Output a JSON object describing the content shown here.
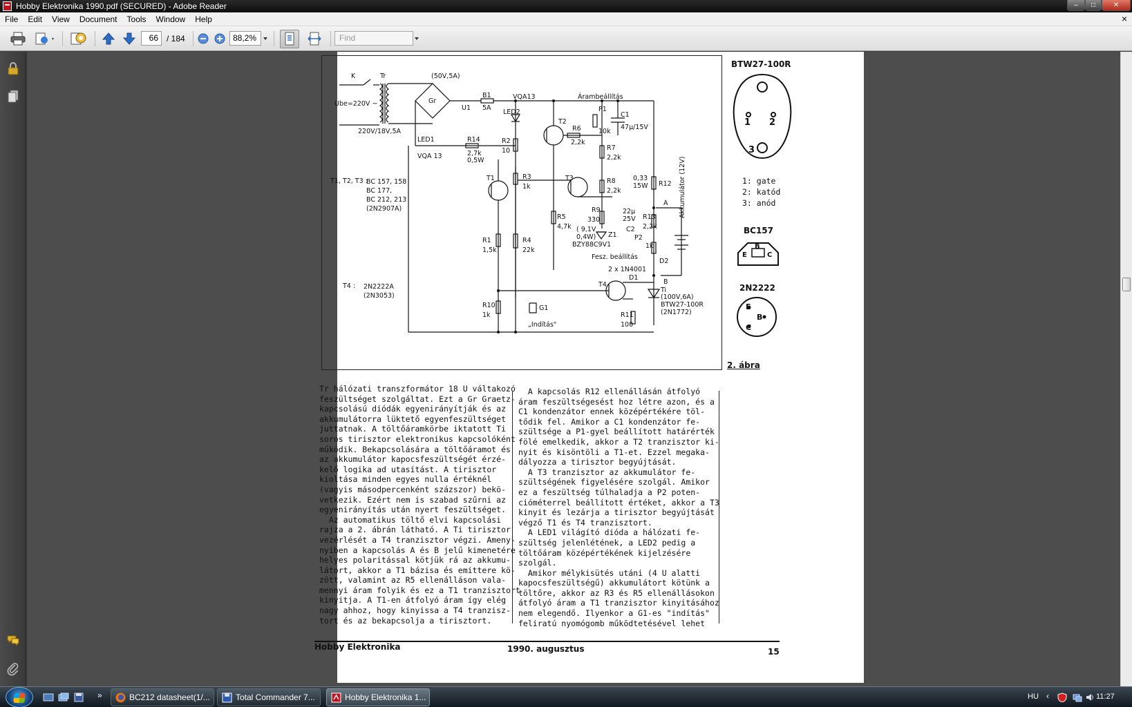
{
  "window": {
    "title": "Hobby Elektronika 1990.pdf (SECURED) - Adobe Reader",
    "controls": {
      "minimize": "–",
      "maximize": "□",
      "close": "✕"
    }
  },
  "menubar": {
    "items": [
      "File",
      "Edit",
      "View",
      "Document",
      "Tools",
      "Window",
      "Help"
    ],
    "close_glyph": "×"
  },
  "toolbar": {
    "page_current": "66",
    "page_total": "/ 184",
    "zoom": "88,2%",
    "find_placeholder": "Find"
  },
  "document": {
    "page": {
      "side": {
        "btw_title": "BTW27-100R",
        "btw_pins": "1: gate\n2: katód\n3: anód",
        "pin1": "1",
        "pin2": "2",
        "pin3": "3",
        "bc157_title": "BC157",
        "bc157_pins": [
          "E",
          "B",
          "C"
        ],
        "n2222_title": "2N2222",
        "n2222_pins": [
          "E",
          "B",
          "C"
        ]
      },
      "schematic": {
        "k": "K",
        "tr": "Tr",
        "rating_bridge": "(50V,5A)",
        "ube": "Ube=220V ~",
        "trafo": "220V/18V,5A",
        "gr": "Gr",
        "u1": "U1",
        "b1": "B1",
        "b1_val": "5A",
        "vqa13_top": "VQA13",
        "led2": "LED2",
        "aram": "Árambeállítás",
        "p1": "P1",
        "p1_val": "10k",
        "c1": "C1",
        "c1_val": "47μ/15V",
        "t2": "T2",
        "r6": "R6",
        "r6_val": "2,2k",
        "r7": "R7",
        "r7_val": "2,2k",
        "led1": "LED1",
        "vqa13_bot": "VQA 13",
        "r14": "R14",
        "r14_val": "2,7k",
        "r14_w": "0,5W",
        "r2": "R2",
        "r2_val": "10",
        "trans_list_label": "T1, T2, T3 :",
        "trans_list": "BC 157, 158\nBC 177,\nBC 212, 213\n(2N2907A)",
        "t1": "T1",
        "r3": "R3",
        "r3_val": "1k",
        "t3": "T3",
        "r8": "R8",
        "r8_val": "2,2k",
        "r12_val": "0,33\n15W",
        "r12": "R12",
        "akku": "Akkumulátor (12V)",
        "a_label": "A",
        "b_label": "B",
        "r5": "R5",
        "r5_val": "4,7k",
        "r9": "R9",
        "r9_val": "330",
        "c2": "C2",
        "c2_val": "22μ\n25V",
        "r13": "R13",
        "r13_val": "2,2k",
        "z1_spec": "( 9,1V\n0,4W)",
        "z1": "Z1",
        "bzy": "BZY88C9V1",
        "p2": "P2",
        "p2_val": "1k",
        "r1": "R1",
        "r1_val": "1,5k",
        "r4": "R4",
        "r4_val": "22k",
        "fesz": "Fesz. beállítás",
        "d2": "D2",
        "diodes": "2 x 1N4001",
        "t4_label": "T4 :",
        "t4_list": "2N2222A\n(2N3053)",
        "t4": "T4",
        "d1": "D1",
        "ti": "Ti",
        "ti_spec": "(100V,6A)\nBTW27-100R\n(2N1772)",
        "r10": "R10",
        "r10_val": "1k",
        "g1": "G1",
        "inditas": "„Indítás\"",
        "r11": "R11",
        "r11_val": "100"
      },
      "caption": "2. ábra",
      "col1": "Tr hálózati transzformátor 18 U váltakozó\nfeszültséget szolgáltat. Ezt a Gr Graetz-\nkapcsolású diódák egyenirányítják és az\nakkumulátorra lüktető egyenfeszültséget\njuttatnak. A töltőáramkörbe iktatott Ti\nsoros tirisztor elektronikus kapcsolóként\nműködik. Bekapcsolására a töltőáramot és\naz akkumulátor kapocsfeszültségét érzé-\nkelő logika ad utasítást. A tirisztor\nkioltása minden egyes nulla értéknél\n(vagyis másodpercenként százszor) bekö-\nvetkezik. Ezért nem is szabad szűrni az\negyenirányítás után nyert feszültséget.\n  Az automatikus töltő elvi kapcsolási\nrajza a 2. ábrán látható. A Ti tirisztor\nvezérlését a T4 tranzisztor végzi. Ameny-\nnyiben a kapcsolás A és B jelű kimenetére\nhelyes polaritással kötjük rá az akkumu-\nlátort, akkor a T1 bázisa és emittere kö-\nzött, valamint az R5 ellenálláson vala-\nmennyi áram folyik és ez a T1 tranzisztort\nkinyitja. A T1-en átfolyó áram így elég\nnagy ahhoz, hogy kinyissa a T4 tranzisz-\ntort és az bekapcsolja a tirisztort.",
      "col2": "  A kapcsolás R12 ellenállásán átfolyó\náram feszültségesést hoz létre azon, és a\nC1 kondenzátor ennek középértékére töl-\ntődik fel. Amikor a C1 kondenzátor fe-\nszültsége a P1-gyel beállított határérték\nfölé emelkedik, akkor a T2 tranzisztor ki-\nnyit és kisöntöli a T1-et. Ezzel megaka-\ndályozza a tirisztor begyújtását.\n  A T3 tranzisztor az akkumulátor fe-\nszültségének figyelésére szolgál. Amikor\nez a feszültség túlhaladja a P2 poten-\ncióméterrel beállított értéket, akkor a T3\nkinyit és lezárja a tirisztor begyújtását\nvégző T1 és T4 tranzisztort.\n  A LED1 világító dióda a hálózati fe-\nszültség jelenlétének, a LED2 pedig a\ntöltőáram középértékének kijelzésére\nszolgál.\n  Amikor mélykisütés utáni (4 U alatti\nkapocsfeszültségű) akkumulátort kötünk a\ntöltőre, akkor az R3 és R5 ellenállásokon\nátfolyó áram a T1 tranzisztor kinyitásához\nnem elegendő. Ilyenkor a G1-es \"indítás\"\nfeliratú nyomógomb működtetésével lehet",
      "footer_left": "Hobby Elektronika",
      "footer_mid": "1990. augusztus",
      "footer_right": "15"
    }
  },
  "taskbar": {
    "tasks": [
      {
        "label": "BC212 datasheet(1/...",
        "icon": "firefox-icon"
      },
      {
        "label": "Total Commander 7...",
        "icon": "total-commander-icon"
      },
      {
        "label": "Hobby Elektronika 1...",
        "icon": "adobe-reader-icon"
      }
    ],
    "chevron": "»",
    "lang": "HU",
    "clock": "11:27"
  },
  "colors": {
    "doc_background": "#4d4d4d",
    "adobe_red": "#c1121f"
  }
}
